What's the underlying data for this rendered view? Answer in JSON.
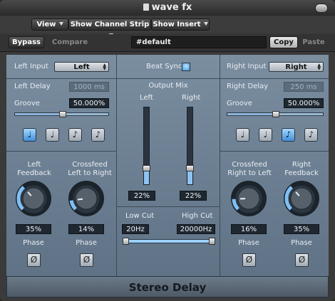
{
  "window": {
    "title": "wave fx"
  },
  "toolbar": {
    "view_label": "View",
    "show_channel_strip_label": "Show Channel Strip",
    "show_insert_label": "Show Insert",
    "bypass_label": "Bypass",
    "compare_label": "Compare",
    "prev_label": "◀",
    "next_label": "▶",
    "preset_value": "#default",
    "copy_label": "Copy",
    "paste_label": "Paste"
  },
  "plugin": {
    "name": "Stereo Delay",
    "left": {
      "input_label": "Left Input",
      "input_value": "Left",
      "delay_label": "Left Delay",
      "delay_value": "1000 ms",
      "groove_label": "Groove",
      "groove_value": "50.000%",
      "groove_fraction": 0.5,
      "note_buttons": [
        "♩",
        "♩",
        "♪",
        "♪"
      ],
      "note_active_index": 0,
      "feedback_label": "Left\nFeedback",
      "feedback_value": "35%",
      "feedback_fraction": 0.35,
      "crossfeed_label": "Crossfeed\nLeft to Right",
      "crossfeed_value": "14%",
      "crossfeed_fraction": 0.14,
      "phase_label": "Phase",
      "phase_symbol": "Ø"
    },
    "center": {
      "beat_sync_label": "Beat Sync",
      "beat_sync_on": true,
      "output_mix_label": "Output Mix",
      "left_label": "Left",
      "right_label": "Right",
      "left_value": "22%",
      "right_value": "22%",
      "left_fraction": 0.22,
      "right_fraction": 0.22,
      "low_cut_label": "Low Cut",
      "high_cut_label": "High Cut",
      "low_cut_value": "20Hz",
      "high_cut_value": "20000Hz"
    },
    "right": {
      "input_label": "Right Input",
      "input_value": "Right",
      "delay_label": "Right Delay",
      "delay_value": "250 ms",
      "groove_label": "Groove",
      "groove_value": "50.000%",
      "groove_fraction": 0.5,
      "note_buttons": [
        "♩",
        "♩",
        "♪",
        "♪"
      ],
      "note_active_index": 2,
      "crossfeed_label": "Crossfeed\nRight to Left",
      "crossfeed_value": "16%",
      "crossfeed_fraction": 0.16,
      "feedback_label": "Right\nFeedback",
      "feedback_value": "35%",
      "feedback_fraction": 0.35,
      "phase_label": "Phase",
      "phase_symbol": "Ø"
    }
  },
  "colors": {
    "panel": "#6a7d8f",
    "accent": "#8fc3f2",
    "field": "#1f2830"
  }
}
